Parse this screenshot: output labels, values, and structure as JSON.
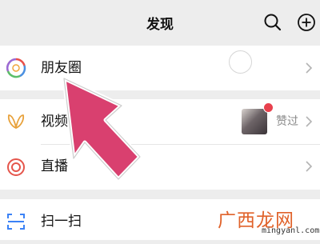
{
  "header": {
    "title": "发现",
    "search_icon": "search-icon",
    "add_icon": "plus-circle-icon"
  },
  "items": {
    "moments": {
      "label": "朋友圈",
      "icon": "aperture-icon"
    },
    "channels": {
      "label": "视频号",
      "icon": "channels-butterfly-icon",
      "badge_text": "赞过"
    },
    "live": {
      "label": "直播",
      "icon": "live-ring-icon"
    },
    "scan": {
      "label": "扫一扫",
      "icon": "scan-icon"
    }
  },
  "colors": {
    "background": "#ededed",
    "card": "#ffffff",
    "badge_red": "#e8414d",
    "arrow_pink": "#d9406f",
    "live_icon": "#e5554b",
    "channels_icon": "#e8a23c",
    "scan_icon": "#3b82f6"
  },
  "watermark": {
    "text": "广西龙网",
    "url": "mingyanl.com"
  }
}
